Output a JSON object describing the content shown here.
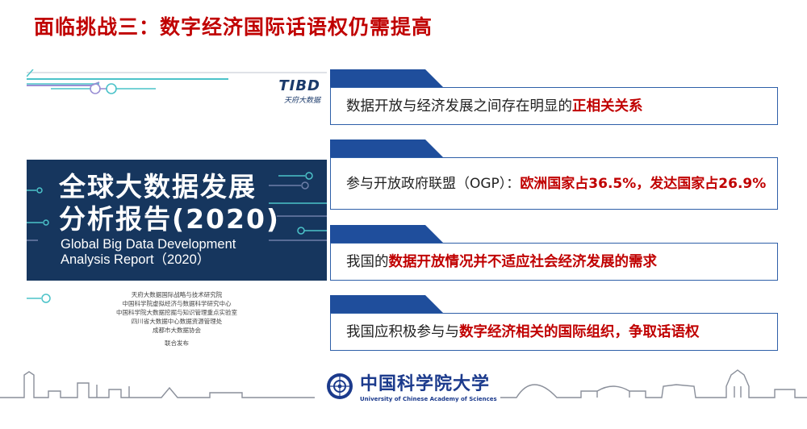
{
  "slide": {
    "title": "面临挑战三：数字经济国际话语权仍需提高"
  },
  "cover": {
    "logo": "TIBD",
    "logo_sub": "天府大数据",
    "title_line1": "全球大数据发展",
    "title_line2": "分析报告(2020)",
    "en_line1": "Global Big Data Development",
    "en_line2": "Analysis Report（2020）",
    "orgs": [
      "天府大数据国际战略与技术研究院",
      "中国科学院虚拟经济与数据科学研究中心",
      "中国科学院大数据挖掘与知识管理重点实验室",
      "四川省大数据中心数据资源管理处",
      "成都市大数据协会"
    ],
    "publish": "联合发布"
  },
  "points": [
    {
      "plain": "数据开放与经济发展之间存在明显的",
      "highlight": "正相关关系",
      "tail": ""
    },
    {
      "plain": "参与开放政府联盟（OGP）：",
      "highlight": "欧洲国家占36.5%，发达国家占26.9%",
      "tail": ""
    },
    {
      "plain": "我国的",
      "highlight": "数据开放情况并不适应社会经济发展的需求",
      "tail": ""
    },
    {
      "plain": "我国应积极参与与",
      "highlight": "数字经济相关的国际组织，争取话语权",
      "tail": ""
    }
  ],
  "footer": {
    "university_cn": "中国科学院大学",
    "university_en": "University of Chinese Academy of Sciences"
  },
  "colors": {
    "title_red": "#c00000",
    "accent_blue": "#2e5fa8",
    "dark_navy": "#16365e"
  }
}
